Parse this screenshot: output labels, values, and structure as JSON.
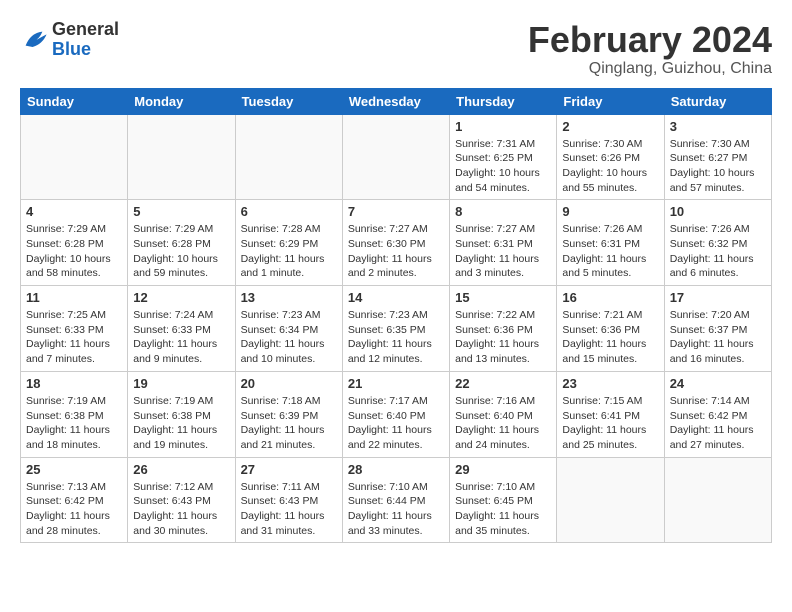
{
  "logo": {
    "general": "General",
    "blue": "Blue"
  },
  "title": "February 2024",
  "location": "Qinglang, Guizhou, China",
  "days_of_week": [
    "Sunday",
    "Monday",
    "Tuesday",
    "Wednesday",
    "Thursday",
    "Friday",
    "Saturday"
  ],
  "weeks": [
    [
      {
        "day": "",
        "info": ""
      },
      {
        "day": "",
        "info": ""
      },
      {
        "day": "",
        "info": ""
      },
      {
        "day": "",
        "info": ""
      },
      {
        "day": "1",
        "info": "Sunrise: 7:31 AM\nSunset: 6:25 PM\nDaylight: 10 hours\nand 54 minutes."
      },
      {
        "day": "2",
        "info": "Sunrise: 7:30 AM\nSunset: 6:26 PM\nDaylight: 10 hours\nand 55 minutes."
      },
      {
        "day": "3",
        "info": "Sunrise: 7:30 AM\nSunset: 6:27 PM\nDaylight: 10 hours\nand 57 minutes."
      }
    ],
    [
      {
        "day": "4",
        "info": "Sunrise: 7:29 AM\nSunset: 6:28 PM\nDaylight: 10 hours\nand 58 minutes."
      },
      {
        "day": "5",
        "info": "Sunrise: 7:29 AM\nSunset: 6:28 PM\nDaylight: 10 hours\nand 59 minutes."
      },
      {
        "day": "6",
        "info": "Sunrise: 7:28 AM\nSunset: 6:29 PM\nDaylight: 11 hours\nand 1 minute."
      },
      {
        "day": "7",
        "info": "Sunrise: 7:27 AM\nSunset: 6:30 PM\nDaylight: 11 hours\nand 2 minutes."
      },
      {
        "day": "8",
        "info": "Sunrise: 7:27 AM\nSunset: 6:31 PM\nDaylight: 11 hours\nand 3 minutes."
      },
      {
        "day": "9",
        "info": "Sunrise: 7:26 AM\nSunset: 6:31 PM\nDaylight: 11 hours\nand 5 minutes."
      },
      {
        "day": "10",
        "info": "Sunrise: 7:26 AM\nSunset: 6:32 PM\nDaylight: 11 hours\nand 6 minutes."
      }
    ],
    [
      {
        "day": "11",
        "info": "Sunrise: 7:25 AM\nSunset: 6:33 PM\nDaylight: 11 hours\nand 7 minutes."
      },
      {
        "day": "12",
        "info": "Sunrise: 7:24 AM\nSunset: 6:33 PM\nDaylight: 11 hours\nand 9 minutes."
      },
      {
        "day": "13",
        "info": "Sunrise: 7:23 AM\nSunset: 6:34 PM\nDaylight: 11 hours\nand 10 minutes."
      },
      {
        "day": "14",
        "info": "Sunrise: 7:23 AM\nSunset: 6:35 PM\nDaylight: 11 hours\nand 12 minutes."
      },
      {
        "day": "15",
        "info": "Sunrise: 7:22 AM\nSunset: 6:36 PM\nDaylight: 11 hours\nand 13 minutes."
      },
      {
        "day": "16",
        "info": "Sunrise: 7:21 AM\nSunset: 6:36 PM\nDaylight: 11 hours\nand 15 minutes."
      },
      {
        "day": "17",
        "info": "Sunrise: 7:20 AM\nSunset: 6:37 PM\nDaylight: 11 hours\nand 16 minutes."
      }
    ],
    [
      {
        "day": "18",
        "info": "Sunrise: 7:19 AM\nSunset: 6:38 PM\nDaylight: 11 hours\nand 18 minutes."
      },
      {
        "day": "19",
        "info": "Sunrise: 7:19 AM\nSunset: 6:38 PM\nDaylight: 11 hours\nand 19 minutes."
      },
      {
        "day": "20",
        "info": "Sunrise: 7:18 AM\nSunset: 6:39 PM\nDaylight: 11 hours\nand 21 minutes."
      },
      {
        "day": "21",
        "info": "Sunrise: 7:17 AM\nSunset: 6:40 PM\nDaylight: 11 hours\nand 22 minutes."
      },
      {
        "day": "22",
        "info": "Sunrise: 7:16 AM\nSunset: 6:40 PM\nDaylight: 11 hours\nand 24 minutes."
      },
      {
        "day": "23",
        "info": "Sunrise: 7:15 AM\nSunset: 6:41 PM\nDaylight: 11 hours\nand 25 minutes."
      },
      {
        "day": "24",
        "info": "Sunrise: 7:14 AM\nSunset: 6:42 PM\nDaylight: 11 hours\nand 27 minutes."
      }
    ],
    [
      {
        "day": "25",
        "info": "Sunrise: 7:13 AM\nSunset: 6:42 PM\nDaylight: 11 hours\nand 28 minutes."
      },
      {
        "day": "26",
        "info": "Sunrise: 7:12 AM\nSunset: 6:43 PM\nDaylight: 11 hours\nand 30 minutes."
      },
      {
        "day": "27",
        "info": "Sunrise: 7:11 AM\nSunset: 6:43 PM\nDaylight: 11 hours\nand 31 minutes."
      },
      {
        "day": "28",
        "info": "Sunrise: 7:10 AM\nSunset: 6:44 PM\nDaylight: 11 hours\nand 33 minutes."
      },
      {
        "day": "29",
        "info": "Sunrise: 7:10 AM\nSunset: 6:45 PM\nDaylight: 11 hours\nand 35 minutes."
      },
      {
        "day": "",
        "info": ""
      },
      {
        "day": "",
        "info": ""
      }
    ]
  ]
}
